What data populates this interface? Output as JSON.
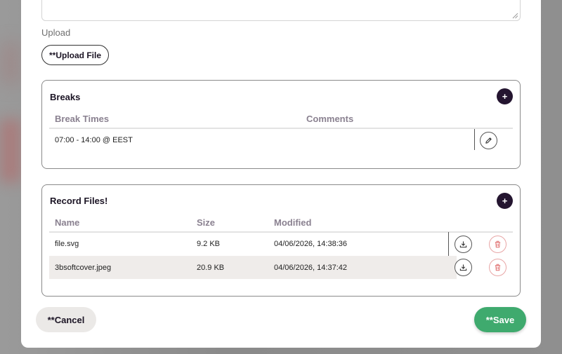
{
  "upload": {
    "label": "Upload",
    "button_label": "**Upload File"
  },
  "breaks": {
    "title": "Breaks",
    "add_label": "+",
    "columns": [
      "Break Times",
      "Comments"
    ],
    "rows": [
      {
        "break_time": "07:00 - 14:00 @ EEST",
        "comment": ""
      }
    ]
  },
  "record_files": {
    "title": "Record Files!",
    "add_label": "+",
    "columns": [
      "Name",
      "Size",
      "Modified"
    ],
    "rows": [
      {
        "name": "file.svg",
        "size": "9.2 KB",
        "modified": "04/06/2026, 14:38:36"
      },
      {
        "name": "3bsoftcover.jpeg",
        "size": "20.9 KB",
        "modified": "04/06/2026, 14:37:42"
      }
    ]
  },
  "footer": {
    "cancel_label": "**Cancel",
    "save_label": "**Save"
  },
  "colors": {
    "primary_dark": "#241530",
    "save_green": "#3faa6e",
    "danger_border": "#e8a6a6",
    "danger_icon": "#e07070"
  },
  "icons": {
    "edit": "pencil-icon",
    "download": "download-icon",
    "delete": "trash-icon",
    "resize": "resize-grip-icon"
  }
}
